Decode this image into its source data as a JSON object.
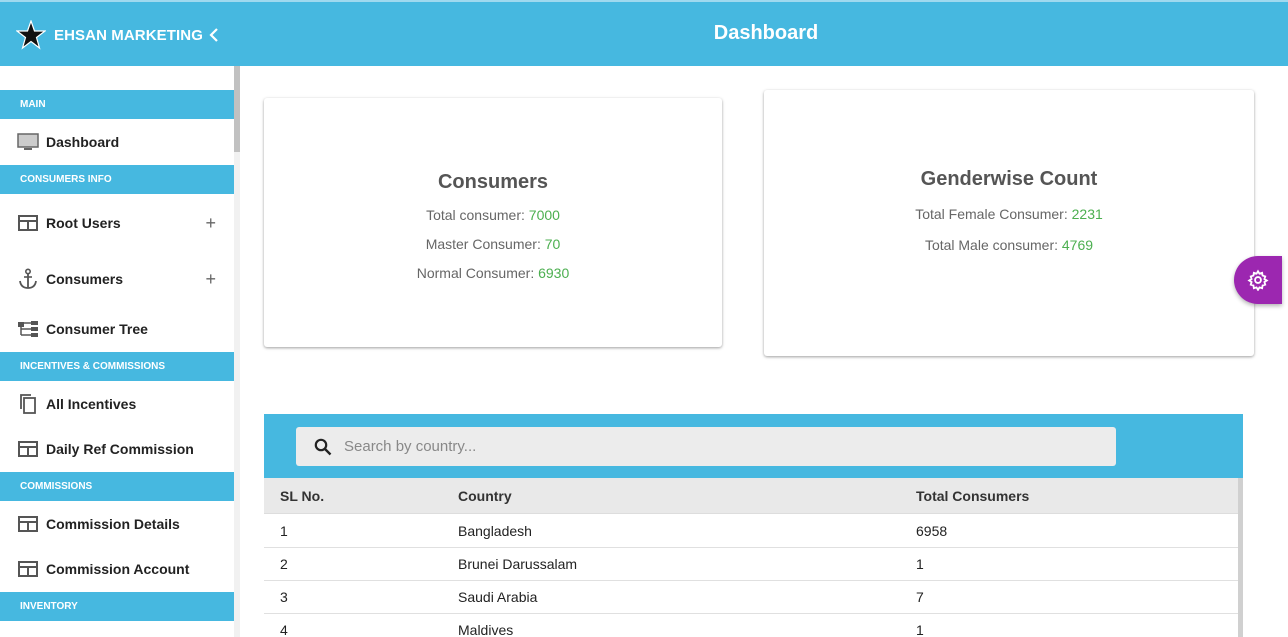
{
  "header": {
    "brand_name": "EHSAN MARKETING",
    "page_title": "Dashboard"
  },
  "sidebar": {
    "sections": [
      {
        "label": "MAIN"
      },
      {
        "label": "CONSUMERS INFO"
      },
      {
        "label": "INCENTIVES & COMMISSIONS"
      },
      {
        "label": "COMMISSIONS"
      },
      {
        "label": "INVENTORY"
      }
    ],
    "items": [
      {
        "label": "Dashboard",
        "icon": "monitor-icon"
      },
      {
        "label": "Root Users",
        "icon": "table-icon"
      },
      {
        "label": "Consumers",
        "icon": "anchor-icon"
      },
      {
        "label": "Consumer Tree",
        "icon": "tree-icon"
      },
      {
        "label": "All Incentives",
        "icon": "copy-icon"
      },
      {
        "label": "Daily Ref Commission",
        "icon": "table-icon"
      },
      {
        "label": "Commission Details",
        "icon": "table-icon"
      },
      {
        "label": "Commission Account",
        "icon": "table-icon"
      }
    ]
  },
  "consumers_card": {
    "title": "Consumers",
    "total_label": "Total consumer: ",
    "total_value": "7000",
    "master_label": "Master Consumer: ",
    "master_value": "70",
    "normal_label": "Normal Consumer: ",
    "normal_value": "6930"
  },
  "gender_card": {
    "title": "Genderwise Count",
    "female_label": "Total Female Consumer: ",
    "female_value": "2231",
    "male_label": "Total Male consumer: ",
    "male_value": "4769"
  },
  "table": {
    "search_placeholder": "Search by country...",
    "columns": [
      "SL No.",
      "Country",
      "Total Consumers"
    ],
    "rows": [
      {
        "sl": "1",
        "country": "Bangladesh",
        "total": "6958"
      },
      {
        "sl": "2",
        "country": "Brunei Darussalam",
        "total": "1"
      },
      {
        "sl": "3",
        "country": "Saudi Arabia",
        "total": "7"
      },
      {
        "sl": "4",
        "country": "Maldives",
        "total": "1"
      }
    ]
  },
  "colors": {
    "primary": "#46b8e0",
    "value_green": "#4caf50",
    "fab_purple": "#9c27b0"
  }
}
